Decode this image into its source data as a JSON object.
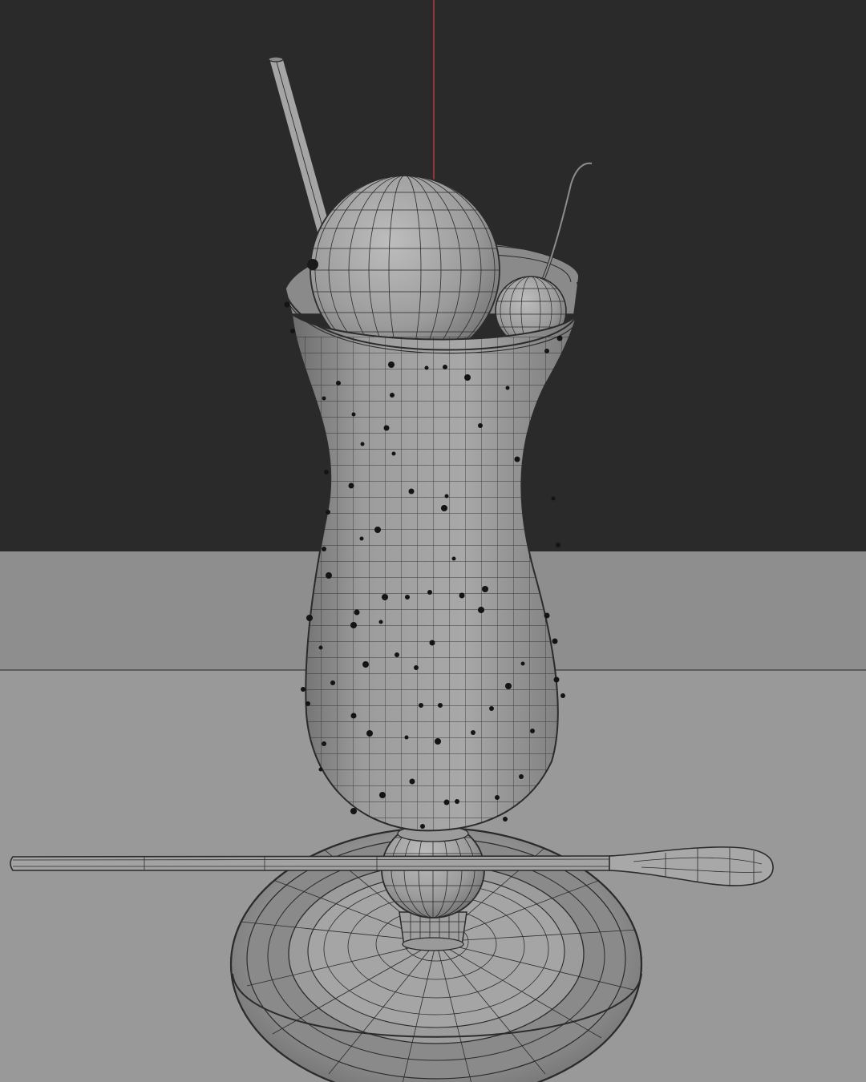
{
  "viewport": {
    "colors": {
      "background": "#2a2a2b",
      "floor": "#8e8e8e",
      "floor_near": "#999999",
      "horizon_line": "#4a4a4a",
      "axis_z": "#b13c45",
      "mesh_fill": "#9a9a9a",
      "mesh_wire": "#2b2b2b",
      "bubbles": "#141414"
    },
    "objects": [
      "hurricane-glass",
      "ice-cream-scoop",
      "cherry",
      "straw",
      "bar-spoon",
      "saucer"
    ]
  }
}
